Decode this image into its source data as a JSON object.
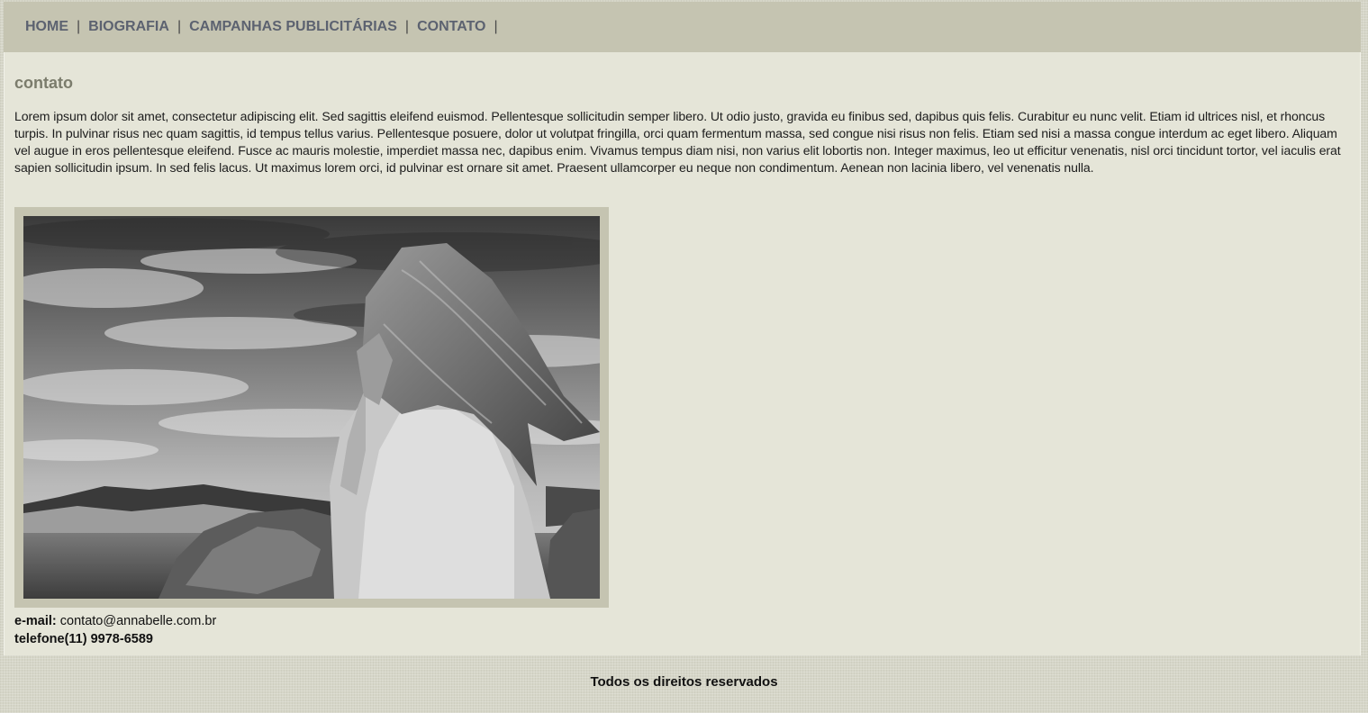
{
  "nav": {
    "items": [
      "HOME",
      "BIOGRAFIA",
      "CAMPANHAS PUBLICITÁRIAS",
      "CONTATO"
    ],
    "separator": "|"
  },
  "page": {
    "title": "contato",
    "body": "Lorem ipsum dolor sit amet, consectetur adipiscing elit. Sed sagittis eleifend euismod. Pellentesque sollicitudin semper libero. Ut odio justo, gravida eu finibus sed, dapibus quis felis. Curabitur eu nunc velit. Etiam id ultrices nisl, et rhoncus turpis. In pulvinar risus nec quam sagittis, id tempus tellus varius. Pellentesque posuere, dolor ut volutpat fringilla, orci quam fermentum massa, sed congue nisi risus non felis. Etiam sed nisi a massa congue interdum ac eget libero. Aliquam vel augue in eros pellentesque eleifend. Fusce ac mauris molestie, imperdiet massa nec, dapibus enim. Vivamus tempus diam nisi, non varius elit lobortis non. Integer maximus, leo ut efficitur venenatis, nisl orci tincidunt tortor, vel iaculis erat sapien sollicitudin ipsum. In sed felis lacus. Ut maximus lorem orci, id pulvinar est ornare sit amet. Praesent ullamcorper eu neque non condimentum. Aenean non lacinia libero, vel venenatis nulla."
  },
  "contact": {
    "email_label": "e-mail:",
    "email_value": "contato@annabelle.com.br",
    "phone_label": "telefone",
    "phone_value": "(11) 9978-6589"
  },
  "footer": {
    "text": "Todos os direitos reservados"
  },
  "colors": {
    "nav_bg": "#c5c4b1",
    "content_bg": "#e5e5d8",
    "nav_text": "#5c6270",
    "title": "#7b7c6c"
  }
}
